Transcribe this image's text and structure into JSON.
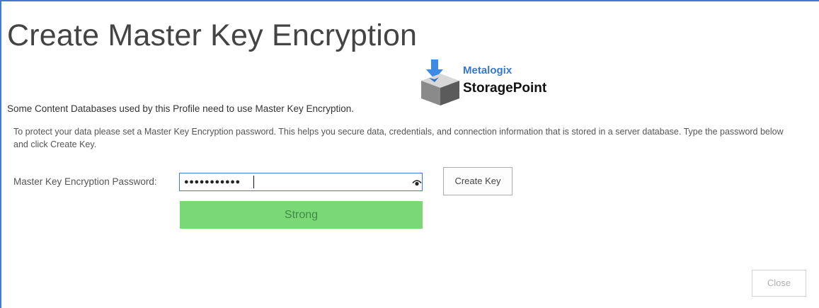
{
  "dialog": {
    "title": "Create Master Key Encryption",
    "note": "Some Content Databases used by this Profile need to use Master Key Encryption.",
    "description": "To protect your data please set a Master Key Encryption password. This helps you secure data, credentials, and connection information that is stored in a server database. Type the password below and click Create Key.",
    "close_label": "Close"
  },
  "logo": {
    "brand_small": "Metalogix",
    "brand_large": "StoragePoint"
  },
  "password": {
    "label": "Master Key Encryption Password:",
    "masked_value": "●●●●●●●●●●●",
    "strength": "Strong",
    "create_key_label": "Create Key",
    "reveal_icon": "eye-icon"
  },
  "colors": {
    "frame_border": "#3e7bd6",
    "strength_bar": "#7bd877",
    "brand_blue": "#3477d1"
  }
}
